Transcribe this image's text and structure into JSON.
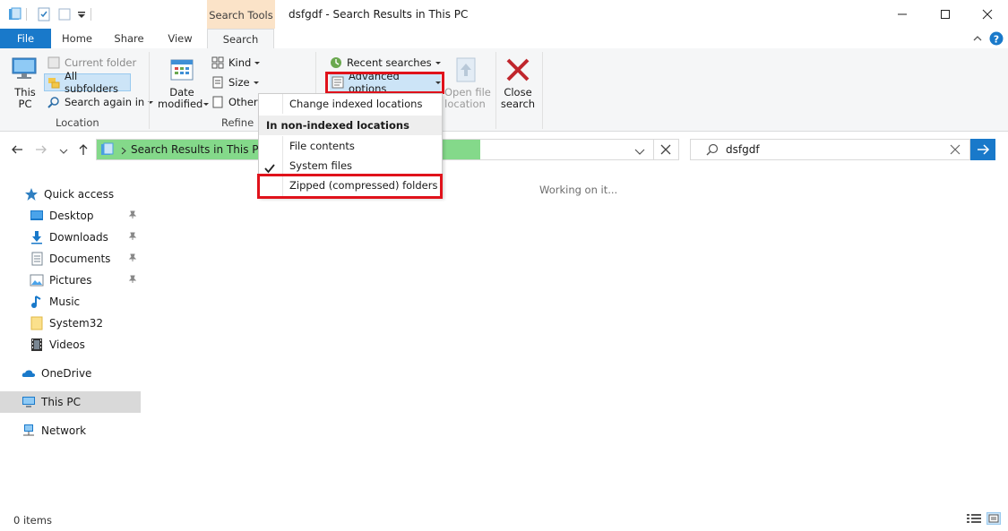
{
  "window": {
    "title": "dsfgdf - Search Results in This PC",
    "context_tab_header": "Search Tools",
    "controls": [
      "minimize",
      "maximize",
      "close"
    ]
  },
  "tabs": [
    "File",
    "Home",
    "Share",
    "View",
    "Search"
  ],
  "ribbon": {
    "location_group": {
      "this_pc_label_line1": "This",
      "this_pc_label_line2": "PC",
      "current_folder": "Current folder",
      "all_subfolders": "All subfolders",
      "search_again_in": "Search again in",
      "label": "Location"
    },
    "refine_group": {
      "date_modified_line1": "Date",
      "date_modified_line2": "modified",
      "kind": "Kind",
      "size": "Size",
      "other": "Other",
      "label": "Refine"
    },
    "options_group": {
      "recent_searches": "Recent searches",
      "advanced_options": "Advanced options",
      "open_file_location_line1": "Open file",
      "open_file_location_line2": "location",
      "close_search_line1": "Close",
      "close_search_line2": "search"
    }
  },
  "dropdown": {
    "change_indexed": "Change indexed locations",
    "section_header": "In non-indexed locations",
    "file_contents": "File contents",
    "system_files": "System files",
    "zipped_folders": "Zipped (compressed) folders",
    "checked": [
      "System files"
    ]
  },
  "address_bar": {
    "path": "Search Results in This PC",
    "progress": 0.66
  },
  "search_box": {
    "value": "dsfgdf"
  },
  "nav_pane": {
    "quick_access": "Quick access",
    "items": [
      {
        "label": "Desktop",
        "pinned": true
      },
      {
        "label": "Downloads",
        "pinned": true
      },
      {
        "label": "Documents",
        "pinned": true
      },
      {
        "label": "Pictures",
        "pinned": true
      },
      {
        "label": "Music",
        "pinned": false
      },
      {
        "label": "System32",
        "pinned": false
      },
      {
        "label": "Videos",
        "pinned": false
      }
    ],
    "onedrive": "OneDrive",
    "this_pc": "This PC",
    "network": "Network"
  },
  "content": {
    "status": "Working on it..."
  },
  "status_bar": {
    "items_count": "0 items"
  },
  "colors": {
    "accent": "#1979ca",
    "context_tab": "#fbe3c8",
    "progress_fill": "#84d98a",
    "highlight_box": "#e0121b",
    "selected_nav": "#d9d9d9"
  }
}
